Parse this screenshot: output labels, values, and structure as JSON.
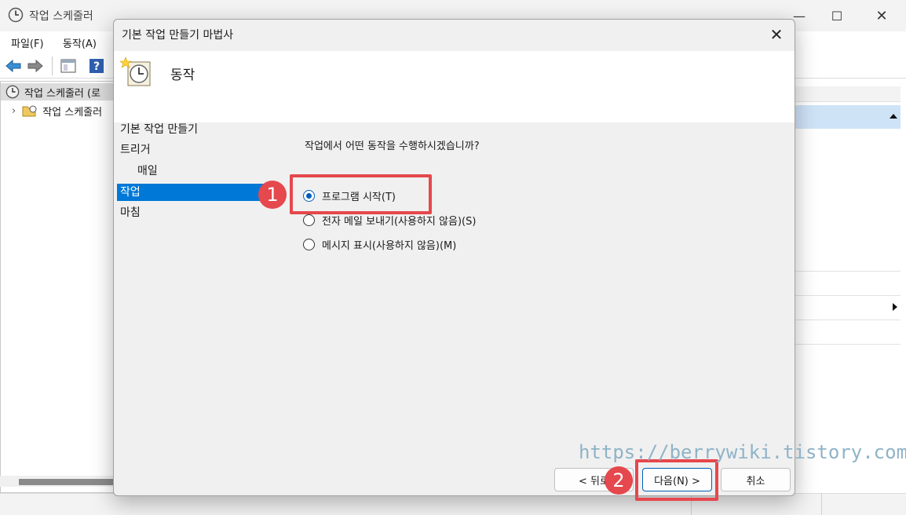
{
  "window": {
    "title": "작업 스케줄러",
    "controls": {
      "minimize": "—",
      "maximize": "☐",
      "close": "✕"
    }
  },
  "menu": {
    "items": [
      {
        "label": "파일(F)"
      },
      {
        "label": "동작(A)"
      }
    ]
  },
  "toolbar": {
    "icons": [
      "back-arrow-icon",
      "forward-arrow-icon",
      "console-tree-icon",
      "help-icon"
    ]
  },
  "tree": {
    "root_label": "작업 스케줄러 (로",
    "child_label": "작업 스케줄러",
    "expand_glyph": "›"
  },
  "dialog": {
    "title": "기본 작업 만들기 마법사",
    "close_glyph": "✕",
    "header_title": "동작",
    "steps": [
      {
        "label": "기본 작업 만들기",
        "active": false,
        "sub": false
      },
      {
        "label": "트리거",
        "active": false,
        "sub": false
      },
      {
        "label": "매일",
        "active": false,
        "sub": true
      },
      {
        "label": "작업",
        "active": true,
        "sub": false
      },
      {
        "label": "마침",
        "active": false,
        "sub": false
      }
    ],
    "question": "작업에서 어떤 동작을 수행하시겠습니까?",
    "options": [
      {
        "label": "프로그램 시작(T)",
        "checked": true
      },
      {
        "label": "전자 메일 보내기(사용하지 않음)(S)",
        "checked": false
      },
      {
        "label": "메시지 표시(사용하지 않음)(M)",
        "checked": false
      }
    ],
    "buttons": {
      "back": "< 뒤로",
      "next": "다음(N) >",
      "cancel": "취소"
    }
  },
  "annotations": {
    "badge1": "1",
    "badge2": "2",
    "color": "#e5484d"
  },
  "watermark": "https://berrywiki.tistory.com",
  "colors": {
    "selection": "#0078d7",
    "accent": "#005fb8",
    "actions_bar": "#cfe3f7"
  }
}
